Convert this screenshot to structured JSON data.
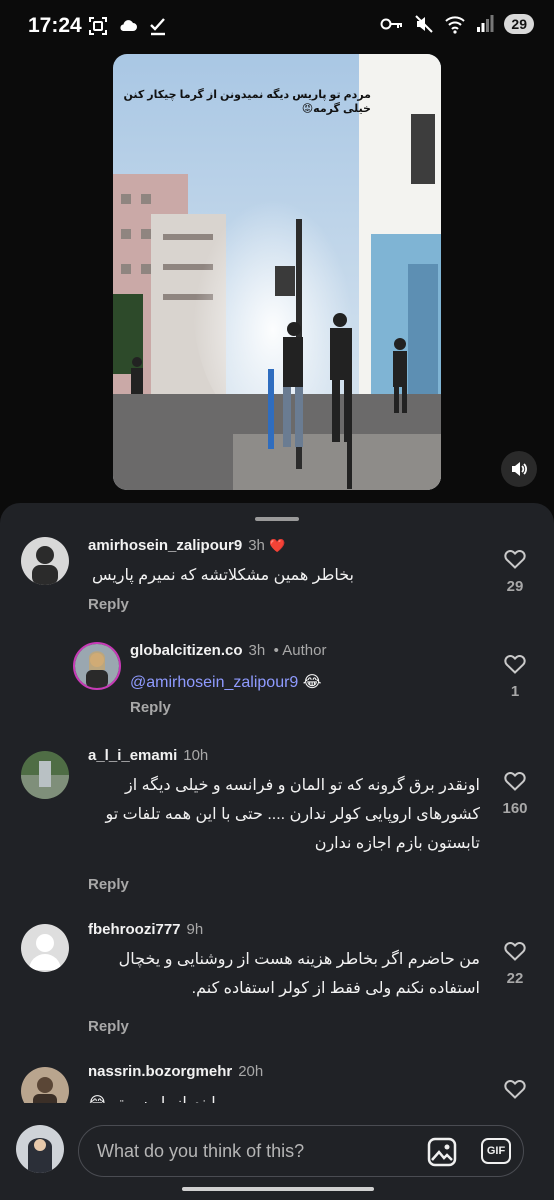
{
  "status": {
    "time": "17:24",
    "battery": "29",
    "left_icons": [
      "screenshot-icon",
      "cloud-icon",
      "check-download-icon"
    ],
    "right_icons": [
      "key-icon",
      "mute-icon",
      "wifi-icon",
      "signal-icon"
    ]
  },
  "video": {
    "caption": "مردم تو پاریس دیگه نمیدونن از گرما چیکار کنن خیلی گرمه😡",
    "mute_icon": "speaker-icon"
  },
  "comments": [
    {
      "user": "amirhosein_zalipour9",
      "time": "3h",
      "badge": "❤️",
      "text": "بخاطر همین مشکلاتشه که نمیرم پاریس",
      "reply_label": "Reply",
      "likes": "29"
    },
    {
      "user": "globalcitizen.co",
      "time": "3h",
      "author_label": "• Author",
      "mention": "@amirhosein_zalipour9",
      "text_after_mention": " 😂",
      "reply_label": "Reply",
      "likes": "1"
    },
    {
      "user": "a_l_i_emami",
      "time": "10h",
      "text": "اونقدر برق گرونه که تو المان و فرانسه و خیلی دیگه از کشورهای اروپایی کولر ندارن .... حتی با این همه تلفات تو تابستون بازم اجازه ندارن",
      "reply_label": "Reply",
      "likes": "160"
    },
    {
      "user": "fbehroozi777",
      "time": "9h",
      "text": "من حاضرم اگر بخاطر هزینه هست از روشنایی و یخچال استفاده نکنم ولی فقط از کولر استفاده کنم.",
      "reply_label": "Reply",
      "likes": "22"
    },
    {
      "user": "nassrin.bozorgmehr",
      "time": "20h",
      "text": "😂 اینم از پاریس تو",
      "likes": ""
    }
  ],
  "composer": {
    "placeholder": "What do you think of this?",
    "gif_label": "GIF"
  }
}
